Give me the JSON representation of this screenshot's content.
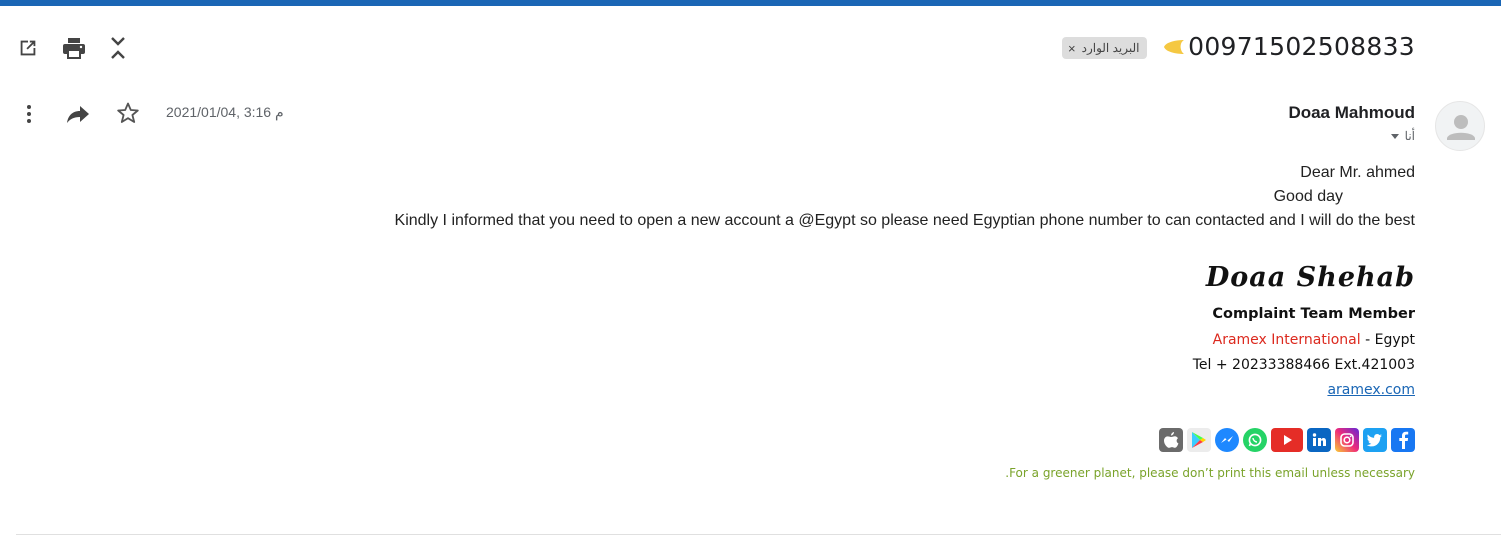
{
  "thread": {
    "subject": "00971502508833",
    "label": "البريد الوارد",
    "label_remove": "×"
  },
  "toolbar": {
    "icons": [
      "open-in-new-window-icon",
      "print-icon",
      "collapse-all-icon"
    ]
  },
  "message": {
    "sender": "Doaa Mahmoud",
    "recipient": "أنا",
    "date": "2021/01/04, 3:16 م",
    "actions": [
      "more-options-icon",
      "forward-icon",
      "star-icon"
    ],
    "body": [
      "Dear Mr. ahmed",
      "Good day",
      "Kindly I informed that you need to open a new account a @Egypt so please need Egyptian phone number to can contacted and I will do the best"
    ]
  },
  "signature": {
    "name": "Doaa Shehab",
    "title": "Complaint Team Member",
    "company": "Aramex International",
    "company_suffix": " - Egypt",
    "tel": "Tel + 20233388466 Ext.421003",
    "link": "aramex.com",
    "social": [
      "apple-icon",
      "google-play-icon",
      "messenger-icon",
      "whatsapp-icon",
      "youtube-icon",
      "linkedin-icon",
      "instagram-icon",
      "twitter-icon",
      "facebook-icon"
    ],
    "green_note": ".For a greener planet, please don’t print this email unless necessary"
  },
  "colors": {
    "top_bar": "#1a66b5",
    "brand_red": "#dc291e",
    "link_blue": "#1a66b5",
    "green_note": "#7aa32b",
    "importance_marker": "#f5c842"
  }
}
